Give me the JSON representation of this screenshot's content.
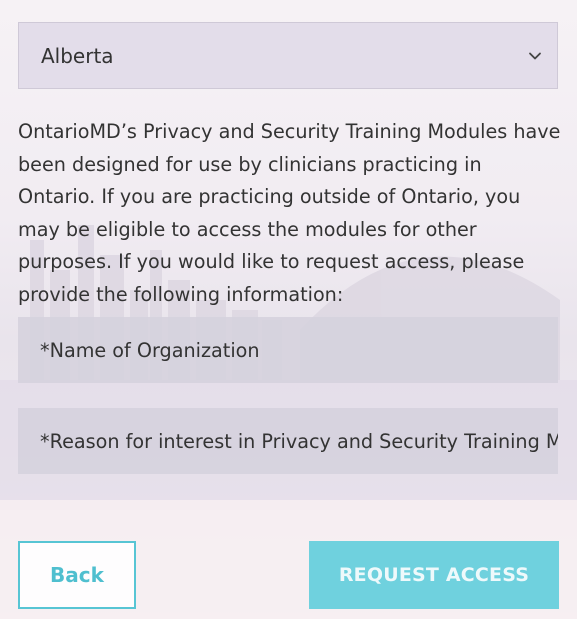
{
  "form": {
    "province_select": {
      "value": "Alberta",
      "icon": "chevron-down-icon"
    },
    "description": "OntarioMD’s Privacy and Security Training Modules have been designed for use by clinicians practicing in Ontario. If you are practicing outside of Ontario, you may be eligible to access the modules for other purposes. If you would like to request access, please provide the following information:",
    "organization_field": {
      "placeholder": "*Name of Organization"
    },
    "reason_field": {
      "placeholder": "*Reason for interest in Privacy and Security Training Modules"
    },
    "back_button": {
      "label": "Back"
    },
    "request_button": {
      "label": "REQUEST ACCESS"
    }
  },
  "colors": {
    "accent": "#57c5d4",
    "request_button_bg": "#6fd1de",
    "field_bg": "#d5d1dd",
    "text": "#333333"
  }
}
